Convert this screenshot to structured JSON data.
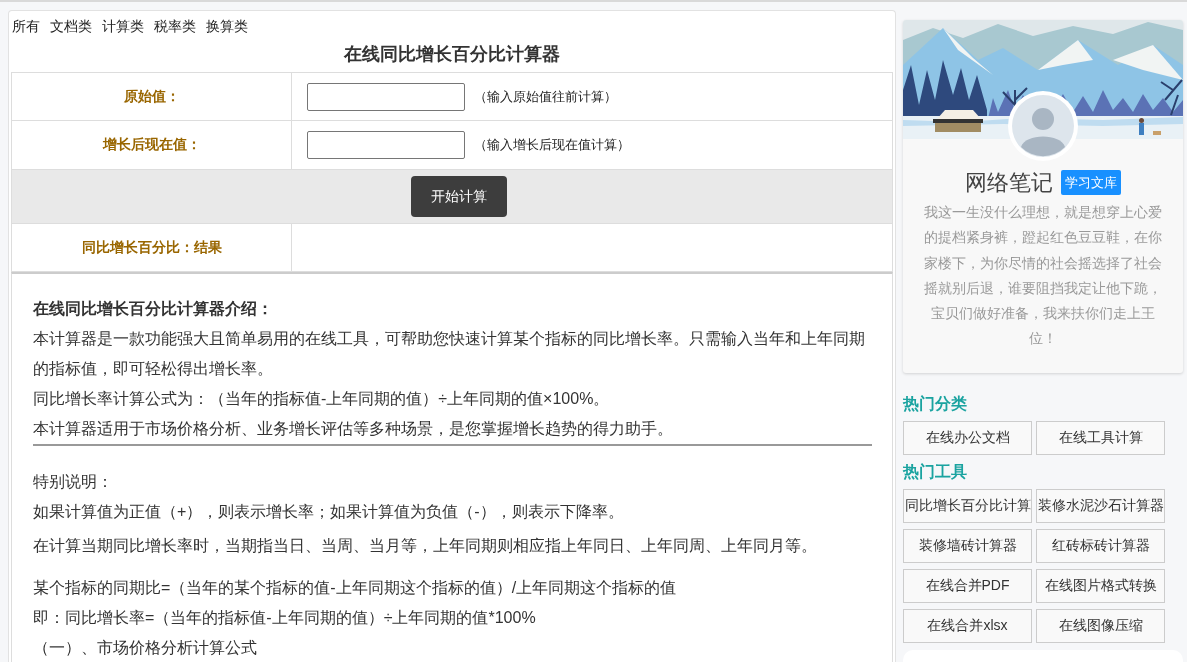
{
  "nav_links": [
    "所有",
    "文档类",
    "计算类",
    "税率类",
    "换算类"
  ],
  "calculator": {
    "title": "在线同比增长百分比计算器",
    "rows": [
      {
        "kind": "input",
        "label": "原始值：",
        "hint": "（输入原始值往前计算）"
      },
      {
        "kind": "input",
        "label": "增长后现在值：",
        "hint": "（输入增长后现在值计算）"
      },
      {
        "kind": "action",
        "button": "开始计算"
      },
      {
        "kind": "result",
        "label": "同比增长百分比：结果"
      }
    ]
  },
  "intro": {
    "heading": "在线同比增长百分比计算器介绍：",
    "paragraphs": [
      "本计算器是一款功能强大且简单易用的在线工具，可帮助您快速计算某个指标的同比增长率。只需输入当年和上年同期的指标值，即可轻松得出增长率。",
      "同比增长率计算公式为：（当年的指标值-上年同期的值）÷上年同期的值×100%。",
      "本计算器适用于市场价格分析、业务增长评估等多种场景，是您掌握增长趋势的得力助手。"
    ]
  },
  "notes": {
    "heading": "特别说明：",
    "lines": [
      "如果计算值为正值（+），则表示增长率；如果计算值为负值（-），则表示下降率。",
      "在计算当期同比增长率时，当期指当日、当周、当月等，上年同期则相应指上年同日、上年同周、上年同月等。"
    ]
  },
  "formulas": {
    "lines": [
      "某个指标的同期比=（当年的某个指标的值-上年同期这个指标的值）/上年同期这个指标的值",
      "即：同比增长率=（当年的指标值-上年同期的值）÷上年同期的值*100%",
      "（一）、市场价格分析计算公式"
    ]
  },
  "sidebar": {
    "profile": {
      "name": "网络笔记",
      "badge": "学习文库",
      "bio": "我这一生没什么理想，就是想穿上心爱的提档紧身裤，蹬起红色豆豆鞋，在你家楼下，为你尽情的社会摇选择了社会摇就别后退，谁要阻挡我定让他下跪，宝贝们做好准备，我来扶你们走上王位！"
    },
    "sections": [
      {
        "heading": "热门分类",
        "links": [
          "在线办公文档",
          "在线工具计算"
        ]
      },
      {
        "heading": "热门工具",
        "links": [
          "同比增长百分比计算",
          "装修水泥沙石计算器",
          "装修墙砖计算器",
          "红砖标砖计算器",
          "在线合并PDF",
          "在线图片格式转换",
          "在线合并xlsx",
          "在线图像压缩"
        ]
      }
    ]
  }
}
